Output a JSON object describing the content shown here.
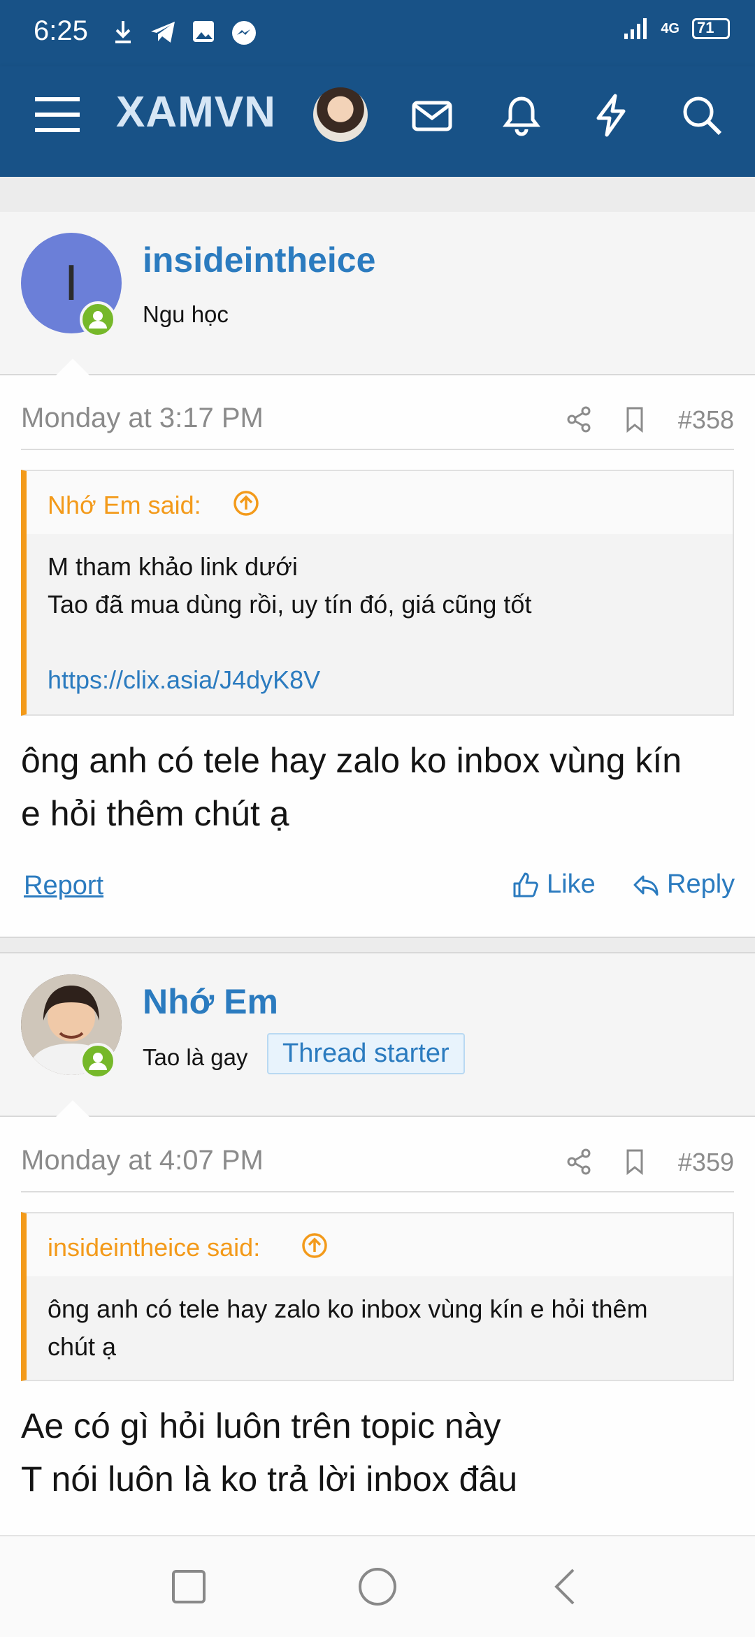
{
  "status_bar": {
    "time": "6:25",
    "network": "4G",
    "battery": "71"
  },
  "app": {
    "logo": "XAMVN"
  },
  "posts": [
    {
      "avatar_letter": "I",
      "username": "insideintheice",
      "user_title": "Ngu học",
      "date": "Monday at 3:17 PM",
      "number": "#358",
      "quote_author": "Nhớ Em said:",
      "quote_lines": [
        "M tham khảo link dưới",
        "Tao đã mua dùng rồi, uy tín đó, giá cũng tốt",
        "https://clix.asia/J4dyK8V"
      ],
      "text_lines": [
        "ông anh có tele hay zalo ko inbox vùng kín",
        "e hỏi thêm chút ạ"
      ],
      "actions": {
        "report": "Report",
        "like": "Like",
        "reply": "Reply"
      }
    },
    {
      "username": "Nhớ Em",
      "user_title": "Tao là gay",
      "badge": "Thread starter",
      "date": "Monday at 4:07 PM",
      "number": "#359",
      "quote_author": "insideintheice said:",
      "quote_lines": [
        "ông anh có tele hay zalo ko inbox vùng kín e hỏi thêm",
        "chút ạ"
      ],
      "text_lines": [
        "Ae có gì hỏi luôn trên topic này",
        "T nói luôn là ko trả lời inbox đâu"
      ]
    }
  ],
  "colors": {
    "header": "#185287",
    "accent": "#2b7bbf",
    "quote_border": "#f39a1a",
    "online": "#76b82a"
  }
}
